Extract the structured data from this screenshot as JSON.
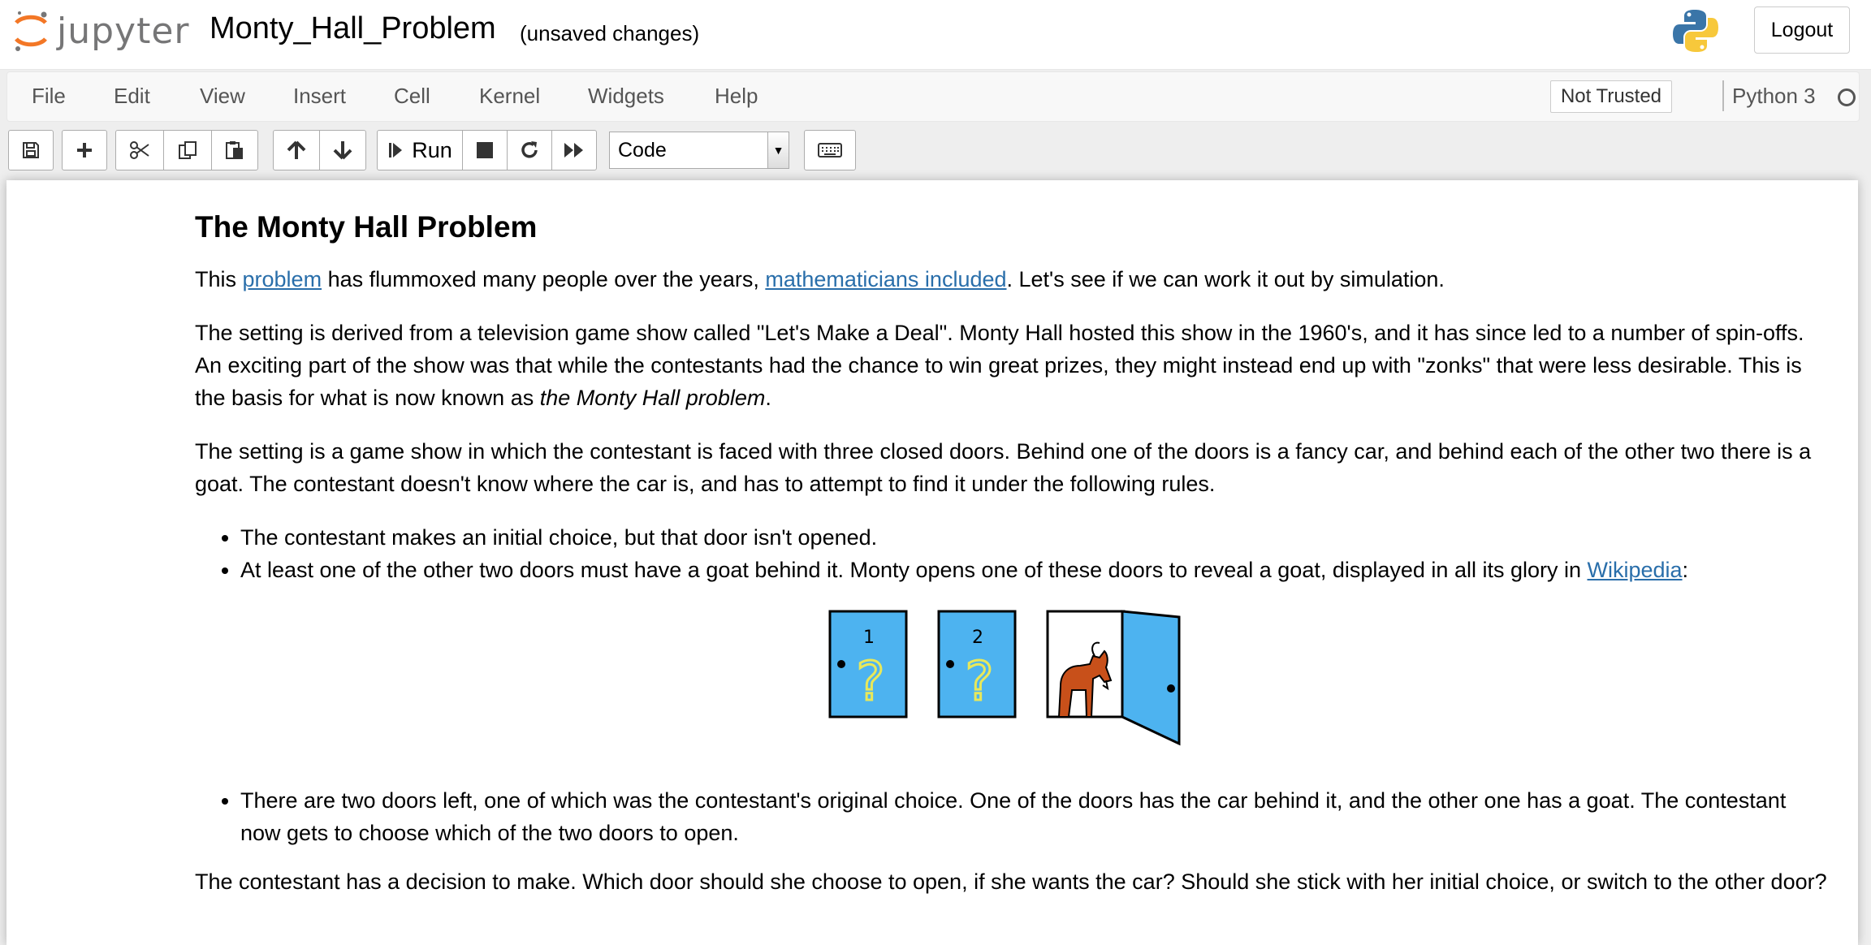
{
  "header": {
    "logo_text": "jupyter",
    "notebook_name": "Monty_Hall_Problem",
    "save_status": "(unsaved changes)",
    "logout_label": "Logout"
  },
  "menubar": {
    "items": [
      "File",
      "Edit",
      "View",
      "Insert",
      "Cell",
      "Kernel",
      "Widgets",
      "Help"
    ],
    "trusted_label": "Not Trusted",
    "kernel_name": "Python 3"
  },
  "toolbar": {
    "run_label": "Run",
    "cell_type": "Code"
  },
  "cell": {
    "heading": "The Monty Hall Problem",
    "p1": {
      "before": "This ",
      "link1": "problem",
      "middle": " has flummoxed many people over the years, ",
      "link2": "mathematicians included",
      "after": ". Let's see if we can work it out by simulation."
    },
    "p2": {
      "text": "The setting is derived from a television game show called \"Let's Make a Deal\". Monty Hall hosted this show in the 1960's, and it has since led to a number of spin-offs. An exciting part of the show was that while the contestants had the chance to win great prizes, they might instead end up with \"zonks\" that were less desirable. This is the basis for what is now known as ",
      "emphasis": "the Monty Hall problem",
      "end": "."
    },
    "p3": "The setting is a game show in which the contestant is faced with three closed doors. Behind one of the doors is a fancy car, and behind each of the other two there is a goat. The contestant doesn't know where the car is, and has to attempt to find it under the following rules.",
    "bullet1": "The contestant makes an initial choice, but that door isn't opened.",
    "bullet2": {
      "text": "At least one of the other two doors must have a goat behind it. Monty opens one of these doors to reveal a goat, displayed in all its glory in ",
      "link": "Wikipedia",
      "end": ":"
    },
    "doors": {
      "door1_number": "1",
      "door2_number": "2",
      "question_mark": "?"
    },
    "bullet3": "There are two doors left, one of which was the contestant's original choice. One of the doors has the car behind it, and the other one has a goat. The contestant now gets to choose which of the two doors to open.",
    "p4": "The contestant has a decision to make. Which door should she choose to open, if she wants the car? Should she stick with her initial choice, or switch to the other door?"
  },
  "colors": {
    "link": "#296eaa",
    "door_fill": "#4db3f0",
    "goat": "#c8501a",
    "question": "#e8e85a"
  }
}
